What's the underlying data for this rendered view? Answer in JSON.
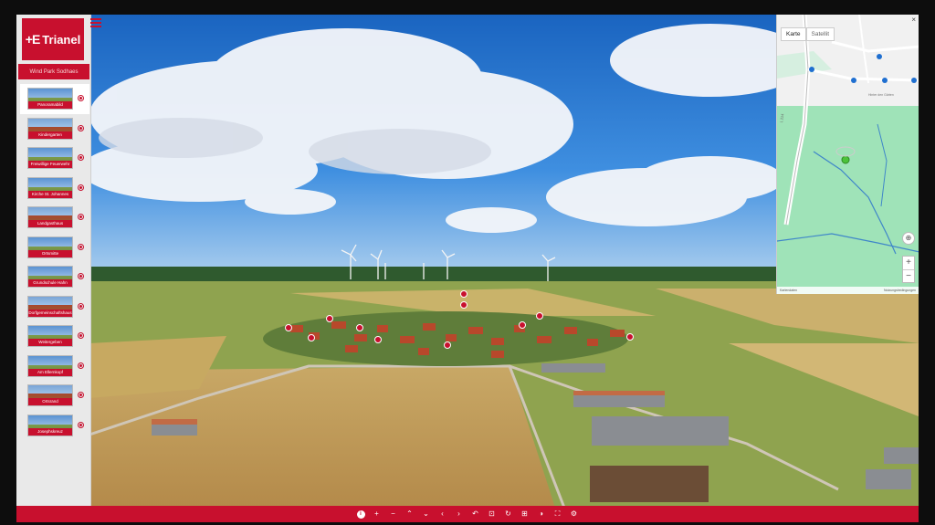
{
  "brand": {
    "logo_text": "Trianel",
    "logo_mark": "+E"
  },
  "sidebar": {
    "subtitle": "Wind Park Sodhaes",
    "items": [
      {
        "label": "Panoramabild",
        "active": true
      },
      {
        "label": "Kindergarten"
      },
      {
        "label": "Freiwillige Feuerwehr"
      },
      {
        "label": "Kirche St. Johannes"
      },
      {
        "label": "Landgasthaus"
      },
      {
        "label": "Ortsmitte"
      },
      {
        "label": "Grundschule Hahn"
      },
      {
        "label": "Dorfgemeinschaftshaus"
      },
      {
        "label": "Weitergeben"
      },
      {
        "label": "Am Ellernkopf"
      },
      {
        "label": "Ortsrand"
      },
      {
        "label": "Josephskreuz"
      }
    ]
  },
  "map": {
    "tab_map": "Karte",
    "tab_satellite": "Satellit",
    "close": "×",
    "zoom_in": "+",
    "zoom_out": "−",
    "locate": "⊕",
    "footer_left": "Kartendaten",
    "footer_right": "Nutzungsbedingungen",
    "road_label": "L 214",
    "street_label": "Hinter den Gärten"
  },
  "toolbar": {
    "buttons": [
      {
        "name": "info",
        "glyph": "i"
      },
      {
        "name": "zoom-in",
        "glyph": "+"
      },
      {
        "name": "zoom-out",
        "glyph": "−"
      },
      {
        "name": "up",
        "glyph": "⌃"
      },
      {
        "name": "down",
        "glyph": "⌄"
      },
      {
        "name": "left",
        "glyph": "‹"
      },
      {
        "name": "right",
        "glyph": "›"
      },
      {
        "name": "undo",
        "glyph": "↶"
      },
      {
        "name": "vr",
        "glyph": "⊡"
      },
      {
        "name": "rotate",
        "glyph": "↻"
      },
      {
        "name": "map",
        "glyph": "⊞"
      },
      {
        "name": "sound",
        "glyph": "◑"
      },
      {
        "name": "fullscreen",
        "glyph": "⛶"
      },
      {
        "name": "settings",
        "glyph": "⚙"
      }
    ]
  },
  "colors": {
    "accent": "#c8102e",
    "map_green": "#9fe3b8",
    "sky": "#1e6fc2"
  }
}
